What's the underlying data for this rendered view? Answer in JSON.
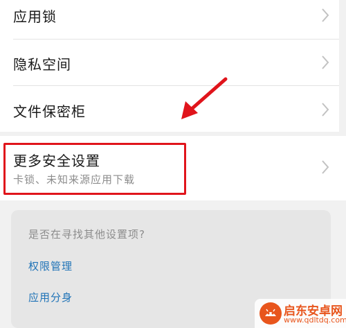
{
  "security_list": {
    "items": [
      {
        "label": "应用锁"
      },
      {
        "label": "隐私空间"
      },
      {
        "label": "文件保密柜"
      }
    ]
  },
  "more_settings": {
    "title": "更多安全设置",
    "subtitle": "卡锁、未知来源应用下载"
  },
  "search_suggestions": {
    "prompt": "是否在寻找其他设置项?",
    "links": [
      {
        "label": "权限管理"
      },
      {
        "label": "应用分身"
      }
    ]
  },
  "watermark": {
    "title": "启东安卓网",
    "url": "www.qdltdq.com"
  },
  "colors": {
    "highlight": "#e0141b",
    "link": "#1f73b7",
    "watermark": "#e8551c"
  },
  "icons": {
    "row_chevron": "chevron-right-icon",
    "annotation": "red-arrow-icon",
    "watermark_logo": "android-logo-icon"
  }
}
